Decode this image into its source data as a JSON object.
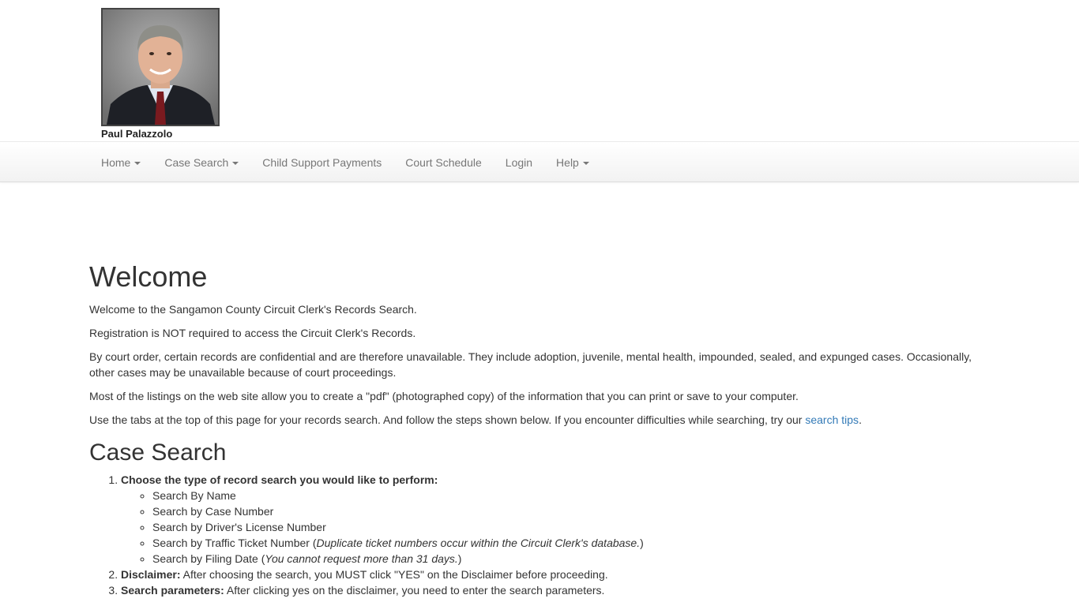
{
  "header": {
    "photo_name": "Paul Palazzolo"
  },
  "nav": {
    "items": [
      {
        "label": "Home",
        "dropdown": true
      },
      {
        "label": "Case Search",
        "dropdown": true
      },
      {
        "label": "Child Support Payments",
        "dropdown": false
      },
      {
        "label": "Court Schedule",
        "dropdown": false
      },
      {
        "label": "Login",
        "dropdown": false
      },
      {
        "label": "Help",
        "dropdown": true
      }
    ]
  },
  "welcome": {
    "title": "Welcome",
    "p1": "Welcome to the Sangamon County Circuit Clerk's Records Search.",
    "p2": "Registration is NOT required to access the Circuit Clerk's Records.",
    "p3": "By court order, certain records are confidential and are therefore unavailable. They include adoption, juvenile, mental health, impounded, sealed, and expunged cases. Occasionally, other cases may be unavailable because of court proceedings.",
    "p4": "Most of the listings on the web site allow you to create a \"pdf\" (photographed copy) of the information that you can print or save to your computer.",
    "p5_text": "Use the tabs at the top of this page for your records search. And follow the steps shown below. If you encounter difficulties while searching, try our ",
    "p5_link": "search tips",
    "p5_end": "."
  },
  "case_search": {
    "title": "Case Search",
    "step1_label": "Choose the type of record search you would like to perform:",
    "step1_options": {
      "o1": "Search By Name",
      "o2": "Search by Case Number",
      "o3": "Search by Driver's License Number",
      "o4_text": "Search by Traffic Ticket Number (",
      "o4_note": "Duplicate ticket numbers occur within the Circuit Clerk's database.",
      "o4_end": ")",
      "o5_text": "Search by Filing Date (",
      "o5_note": "You cannot request more than 31 days.",
      "o5_end": ")"
    },
    "step2_label": "Disclaimer:",
    "step2_text": " After choosing the search, you MUST click \"YES\" on the Disclaimer before proceeding.",
    "step3_label": "Search parameters:",
    "step3_text": " After clicking yes on the disclaimer, you need to enter the search parameters."
  },
  "colors": {
    "link": "#337ab7",
    "nav_text": "#777777",
    "body_text": "#333333"
  }
}
